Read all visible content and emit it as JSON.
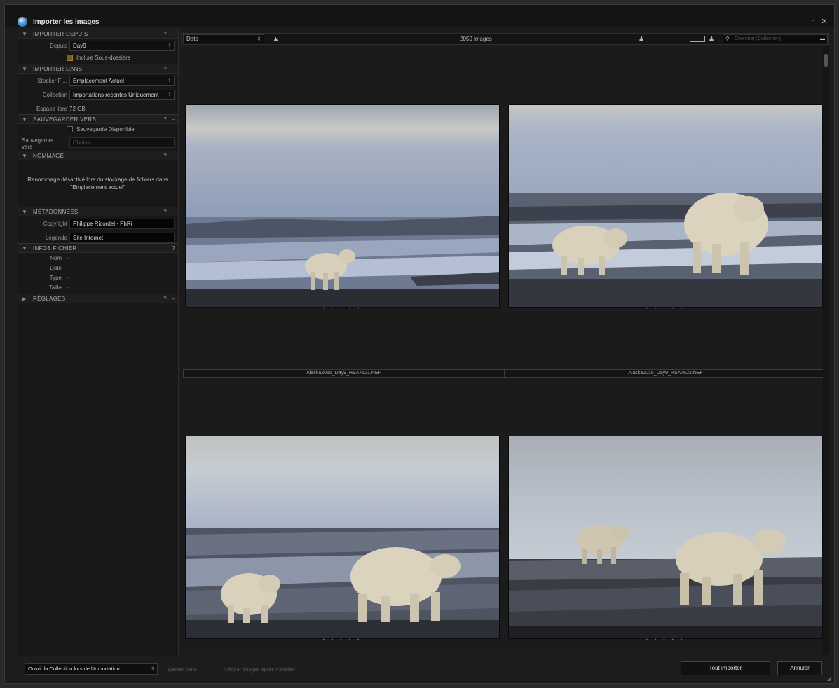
{
  "window": {
    "title": "Importer les images"
  },
  "sidebar": {
    "import_from": {
      "header": "IMPORTER DEPUIS",
      "from_label": "Depuis",
      "from_value": "Day9",
      "subfolders_label": "Inclure Sous-dossiers"
    },
    "import_to": {
      "header": "IMPORTER DANS",
      "folder_label": "Stocker Fi...",
      "folder_value": "Emplacement Actuel",
      "collection_label": "Collection",
      "collection_value": "Importations récentes Uniquement",
      "space_label": "Espace libre",
      "space_value": "72 GB"
    },
    "backup": {
      "header": "SAUVEGARDER VERS",
      "backup_label": "Sauvegarde Disponible",
      "to_label": "Sauvegarder vers",
      "to_value": "Choisir..."
    },
    "naming": {
      "header": "NOMMAGE",
      "note": "Renommage désactivé lors du stockage de fichiers dans \"Emplacement actuel\""
    },
    "metadata": {
      "header": "MÉTADONNÉES",
      "copyright_label": "Copyright",
      "copyright_value": "Philippe Ricordel - PhRi",
      "caption_label": "Légende",
      "caption_value": "Site Internet"
    },
    "fileinfo": {
      "header": "INFOS FICHIER",
      "name_label": "Nom",
      "date_label": "Date",
      "type_label": "Type",
      "size_label": "Taille",
      "empty": "--"
    },
    "settings": {
      "header": "RÉGLAGES"
    }
  },
  "toolbar": {
    "sort": "Date",
    "count": "2059 images",
    "search_placeholder": "Chercher (Collection)"
  },
  "grid": {
    "rating_dots": "• • • • •",
    "filenames": [
      "Alaska2015_Day9_HSA7621.NEF",
      "Alaska2015_Day9_HSA7622.NEF"
    ]
  },
  "bottom": {
    "open_collection": "Ouvrir la Collection lors de l'Importation",
    "eject": "Éjecter carte",
    "show_after": "Afficher images après transfert",
    "import_all": "Tout importer",
    "cancel": "Annuler"
  },
  "colors": {
    "window_bg": "#1c1c1c",
    "sidebar_bg": "#181818",
    "accent_checkbox": "#b07a30"
  }
}
